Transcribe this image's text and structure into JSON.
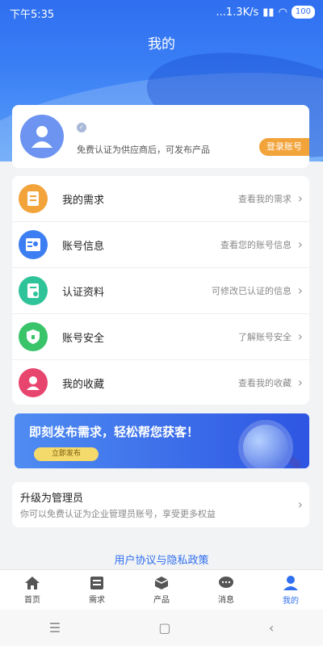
{
  "statusbar": {
    "time": "下午5:35",
    "speed": "...1.3K/s",
    "battery": "100"
  },
  "header": {
    "title": "我的"
  },
  "profile": {
    "verify_badge": "✓",
    "subtitle": "免费认证为供应商后，可发布产品",
    "login_label": "登录账号"
  },
  "menu": {
    "items": [
      {
        "label": "我的需求",
        "hint": "查看我的需求",
        "color": "#f2a33a",
        "icon": "document-icon"
      },
      {
        "label": "账号信息",
        "hint": "查看您的账号信息",
        "color": "#3d7ef2",
        "icon": "id-card-icon"
      },
      {
        "label": "认证资料",
        "hint": "可修改已认证的信息",
        "color": "#2fc39a",
        "icon": "certificate-icon"
      },
      {
        "label": "账号安全",
        "hint": "了解账号安全",
        "color": "#39c46a",
        "icon": "shield-icon"
      },
      {
        "label": "我的收藏",
        "hint": "查看我的收藏",
        "color": "#e8456e",
        "icon": "user-star-icon"
      }
    ]
  },
  "banner": {
    "title": "即刻发布需求，轻松帮您获客！",
    "button": "立即发布"
  },
  "admin": {
    "title": "升级为管理员",
    "subtitle": "你可以免费认证为企业管理员账号，享受更多权益"
  },
  "policy": {
    "text": "用户协议与隐私政策"
  },
  "tabs": [
    {
      "label": "首页",
      "icon": "home-icon"
    },
    {
      "label": "需求",
      "icon": "list-icon"
    },
    {
      "label": "产品",
      "icon": "box-icon"
    },
    {
      "label": "消息",
      "icon": "chat-icon"
    },
    {
      "label": "我的",
      "icon": "person-icon",
      "active": true
    }
  ],
  "navbar": {
    "menu": "☰",
    "home": "▢",
    "back": "‹"
  }
}
